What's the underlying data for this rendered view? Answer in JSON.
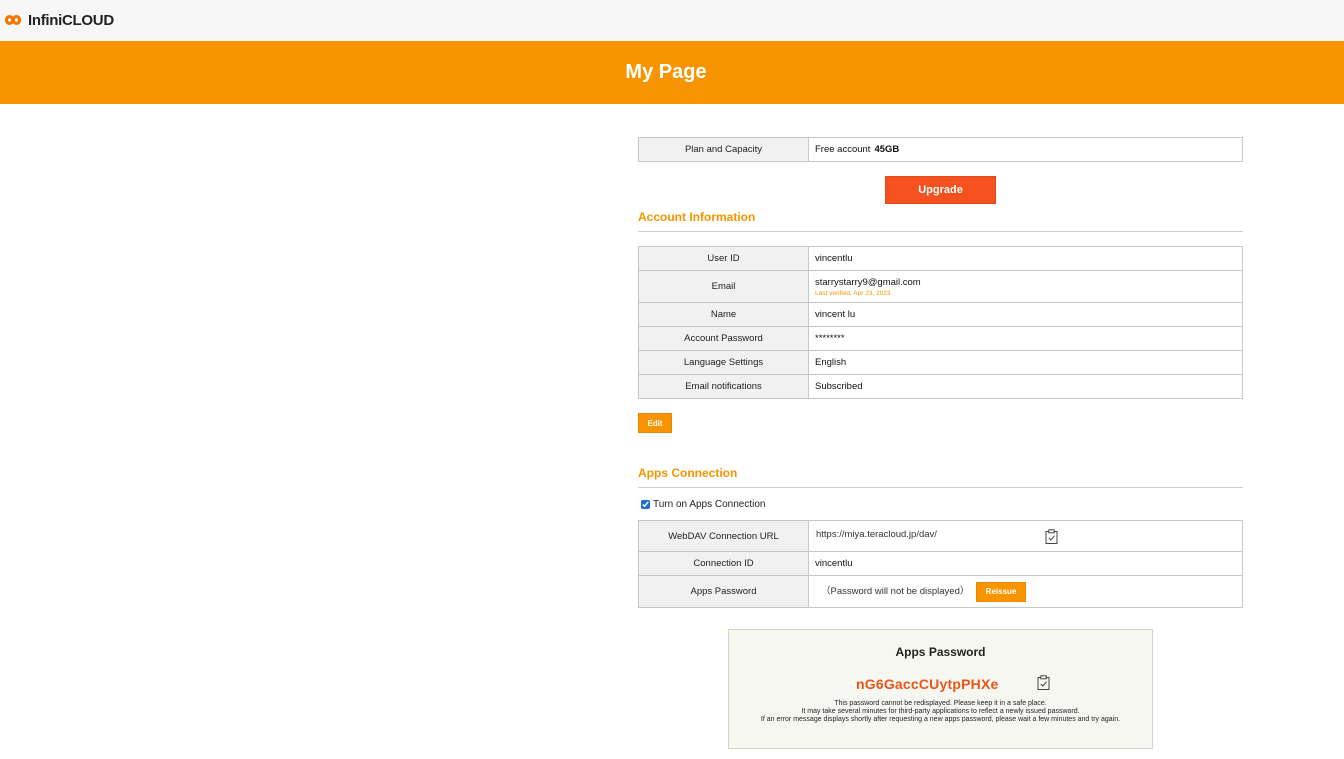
{
  "header": {
    "logo_text": "InfiniCLOUD",
    "page_title": "My Page"
  },
  "plan": {
    "label": "Plan and Capacity",
    "account_type": "Free account",
    "capacity": "45GB",
    "upgrade_label": "Upgrade"
  },
  "account": {
    "section_title": "Account Information",
    "rows": [
      {
        "label": "User ID",
        "value": "vincentlu"
      },
      {
        "label": "Email",
        "value": "starrystarry9@gmail.com",
        "note": "Last verified, Apr 23, 2023"
      },
      {
        "label": "Name",
        "value": "vincent lu"
      },
      {
        "label": "Account Password",
        "value": "********"
      },
      {
        "label": "Language Settings",
        "value": "English"
      },
      {
        "label": "Email notifications",
        "value": "Subscribed"
      }
    ],
    "edit_label": "Edit"
  },
  "apps": {
    "section_title": "Apps Connection",
    "toggle_label": "Turn on Apps Connection",
    "toggle_checked": true,
    "webdav_label": "WebDAV Connection URL",
    "webdav_url": "https://miya.teracloud.jp/dav/",
    "connection_id_label": "Connection ID",
    "connection_id": "vincentlu",
    "apps_password_label": "Apps Password",
    "apps_password_note": "（Password will not be displayed）",
    "reissue_label": "Reissue"
  },
  "new_password": {
    "title": "Apps Password",
    "value": "nG6GaccCUytpPHXe",
    "notes": [
      "This password cannot be redisplayed. Please keep it in a safe place.",
      "It may take several minutes for third-party applications to reflect a newly issued password.",
      "If an error message displays shortly after requesting a new apps password, please wait a few minutes and try again."
    ]
  },
  "colors": {
    "brand_orange": "#f79400",
    "upgrade_red": "#f4511e",
    "password_orange": "#e8561a"
  }
}
